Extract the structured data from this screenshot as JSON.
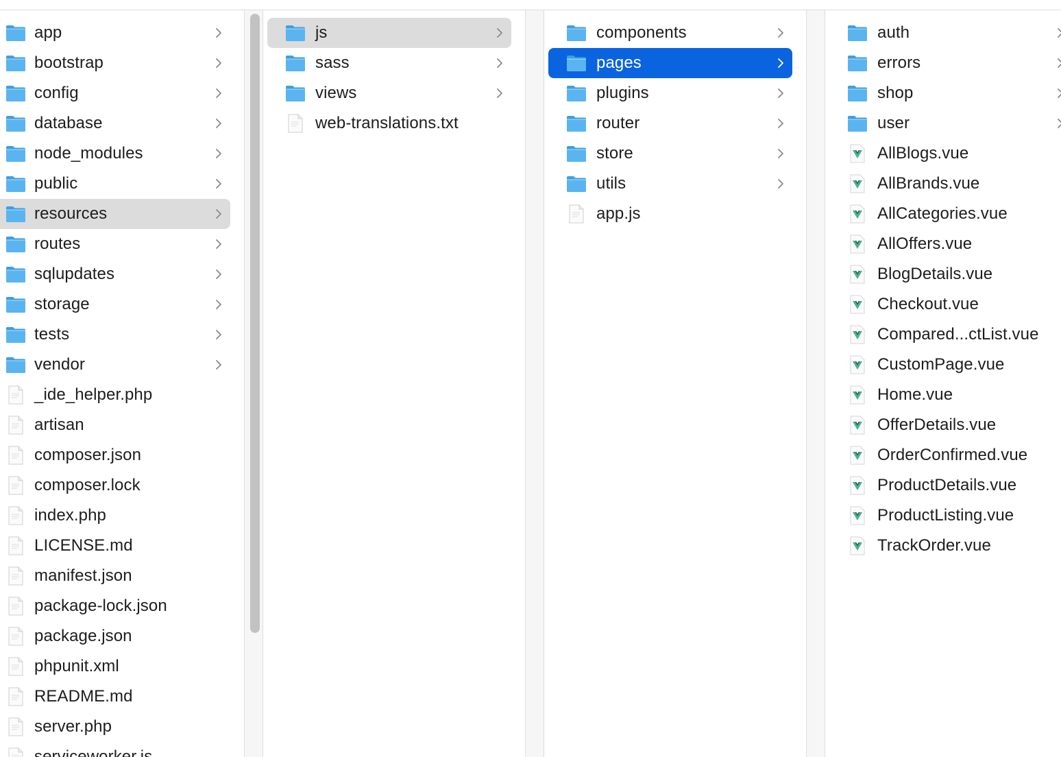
{
  "columns": [
    {
      "items": [
        {
          "name": "app",
          "type": "folder"
        },
        {
          "name": "bootstrap",
          "type": "folder"
        },
        {
          "name": "config",
          "type": "folder"
        },
        {
          "name": "database",
          "type": "folder"
        },
        {
          "name": "node_modules",
          "type": "folder"
        },
        {
          "name": "public",
          "type": "folder"
        },
        {
          "name": "resources",
          "type": "folder",
          "selected": "inactive"
        },
        {
          "name": "routes",
          "type": "folder"
        },
        {
          "name": "sqlupdates",
          "type": "folder"
        },
        {
          "name": "storage",
          "type": "folder"
        },
        {
          "name": "tests",
          "type": "folder"
        },
        {
          "name": "vendor",
          "type": "folder"
        },
        {
          "name": "_ide_helper.php",
          "type": "file"
        },
        {
          "name": "artisan",
          "type": "file"
        },
        {
          "name": "composer.json",
          "type": "file"
        },
        {
          "name": "composer.lock",
          "type": "file"
        },
        {
          "name": "index.php",
          "type": "file"
        },
        {
          "name": "LICENSE.md",
          "type": "file"
        },
        {
          "name": "manifest.json",
          "type": "file"
        },
        {
          "name": "package-lock.json",
          "type": "file"
        },
        {
          "name": "package.json",
          "type": "file"
        },
        {
          "name": "phpunit.xml",
          "type": "file"
        },
        {
          "name": "README.md",
          "type": "file"
        },
        {
          "name": "server.php",
          "type": "file"
        },
        {
          "name": "serviceworker.js",
          "type": "file"
        }
      ]
    },
    {
      "items": [
        {
          "name": "js",
          "type": "folder",
          "selected": "inactive"
        },
        {
          "name": "sass",
          "type": "folder"
        },
        {
          "name": "views",
          "type": "folder"
        },
        {
          "name": "web-translations.txt",
          "type": "file"
        }
      ]
    },
    {
      "items": [
        {
          "name": "components",
          "type": "folder"
        },
        {
          "name": "pages",
          "type": "folder",
          "selected": "active"
        },
        {
          "name": "plugins",
          "type": "folder"
        },
        {
          "name": "router",
          "type": "folder"
        },
        {
          "name": "store",
          "type": "folder"
        },
        {
          "name": "utils",
          "type": "folder"
        },
        {
          "name": "app.js",
          "type": "file"
        }
      ]
    },
    {
      "items": [
        {
          "name": "auth",
          "type": "folder"
        },
        {
          "name": "errors",
          "type": "folder"
        },
        {
          "name": "shop",
          "type": "folder"
        },
        {
          "name": "user",
          "type": "folder"
        },
        {
          "name": "AllBlogs.vue",
          "type": "vue"
        },
        {
          "name": "AllBrands.vue",
          "type": "vue"
        },
        {
          "name": "AllCategories.vue",
          "type": "vue"
        },
        {
          "name": "AllOffers.vue",
          "type": "vue"
        },
        {
          "name": "BlogDetails.vue",
          "type": "vue"
        },
        {
          "name": "Checkout.vue",
          "type": "vue"
        },
        {
          "name": "Compared...ctList.vue",
          "type": "vue"
        },
        {
          "name": "CustomPage.vue",
          "type": "vue"
        },
        {
          "name": "Home.vue",
          "type": "vue"
        },
        {
          "name": "OfferDetails.vue",
          "type": "vue"
        },
        {
          "name": "OrderConfirmed.vue",
          "type": "vue"
        },
        {
          "name": "ProductDetails.vue",
          "type": "vue"
        },
        {
          "name": "ProductListing.vue",
          "type": "vue"
        },
        {
          "name": "TrackOrder.vue",
          "type": "vue"
        }
      ]
    }
  ],
  "colors": {
    "selection_active": "#0a64e0",
    "selection_inactive": "#dcdcdc",
    "folder": "#5ab4f0",
    "vue_green": "#41b883",
    "vue_dark": "#35495e"
  }
}
